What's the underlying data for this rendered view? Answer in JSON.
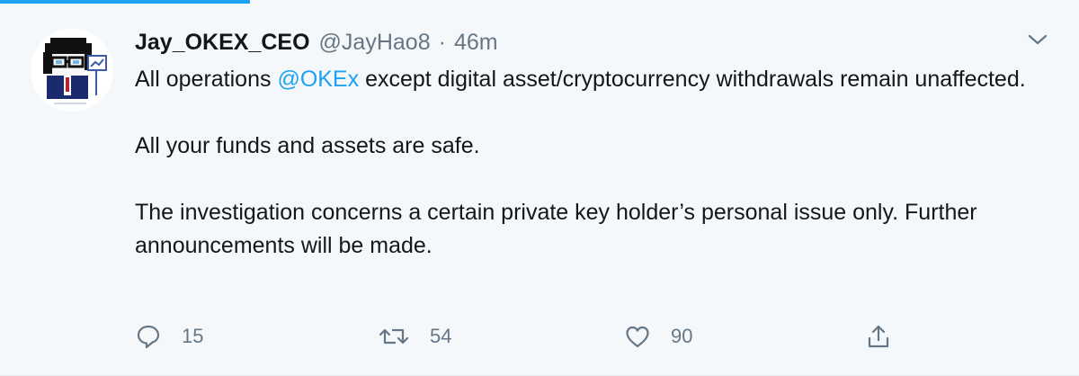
{
  "tweet": {
    "display_name": "Jay_OKEX_CEO",
    "handle": "@JayHao8",
    "separator": "·",
    "time": "46m",
    "text": {
      "line1_prefix": "All operations ",
      "mention": "@OKEx",
      "line1_suffix": " except digital asset/cryptocurrency withdrawals remain unaffected.",
      "paragraph2": "All your funds and assets are safe.",
      "paragraph3": "The investigation concerns a certain private key holder’s personal issue only. Further announcements will be made."
    },
    "actions": {
      "replies": "15",
      "retweets": "54",
      "likes": "90"
    }
  },
  "icons": {
    "reply": "reply-icon",
    "retweet": "retweet-icon",
    "like": "heart-icon",
    "share": "share-icon",
    "menu": "chevron-down-icon"
  },
  "colors": {
    "background": "#f5f8fa",
    "text": "#14171a",
    "secondary": "#657786",
    "accent": "#1da1f2"
  }
}
